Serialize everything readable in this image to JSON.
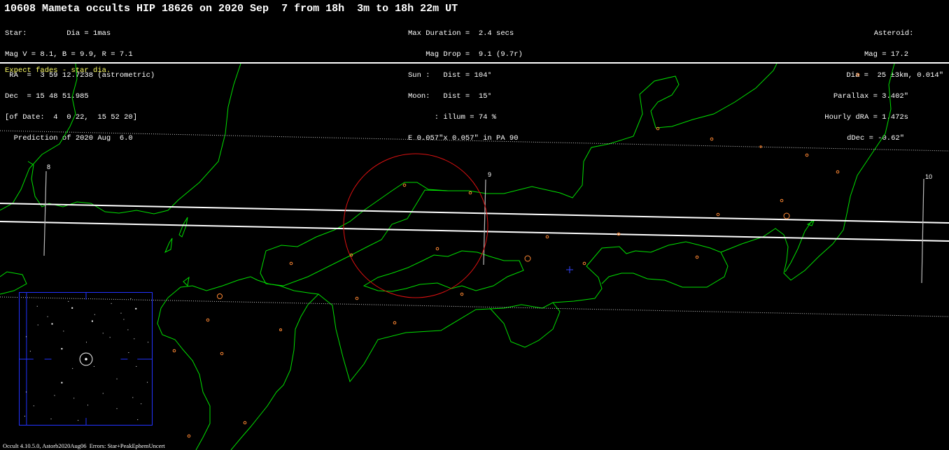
{
  "header": {
    "title": "10608 Mameta occults HIP 18626 on 2020 Sep  7 from 18h  3m to 18h 22m UT"
  },
  "star_info": [
    "Star:         Dia = 1mas",
    "Mag V = 8.1, B = 9.9, R = 7.1",
    " RA  =  3 59 12.7238 (astrometric)",
    "Dec  = 15 48 51.985",
    "[of Date:  4  0 22,  15 52 20]",
    "  Prediction of 2020 Aug  6.0"
  ],
  "event_info": [
    "Max Duration =  2.4 secs",
    "    Mag Drop =  9.1 (9.7r)",
    "Sun :   Dist = 104°",
    "Moon:   Dist =  15°",
    "      : illum = 74 %",
    "E 0.057\"x 0.057\" in PA 90"
  ],
  "asteroid_info": [
    "Asteroid:  ",
    "Mag = 17.2",
    "Dia =  25 ±3km, 0.014\"",
    "Parallax = 3.402\"",
    "Hourly dRA = 1.472s",
    "dDec = -0.62\""
  ],
  "notice": "Expect fades - star dia.",
  "footer": "Occult 4.10.5.0, Astorb2020Aug06  Errors: Star+PeakEphemUncert",
  "time_ticks": [
    "8",
    "9",
    "10"
  ],
  "colors": {
    "coastline": "#00e000",
    "path_limits": "#ffffff",
    "error_limits": "#cccccc",
    "town_markers": "#ff8833",
    "range_circle": "#dd1111",
    "center_cross": "#3344ff",
    "notice_text": "#ffff66",
    "finder_border": "#2233ff"
  }
}
